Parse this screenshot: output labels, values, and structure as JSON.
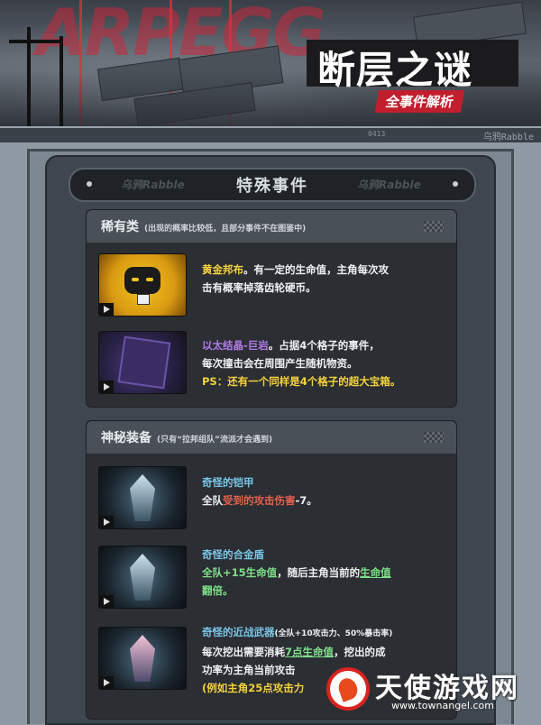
{
  "banner": {
    "bg_logo": "ARPEGG",
    "title": "断层之谜",
    "subtitle": "全事件解析",
    "strip_tag": "乌鸦Rabble",
    "strip_mid": "0413"
  },
  "header": {
    "title": "特殊事件",
    "watermark_left": "乌鸦Rabble",
    "watermark_right": "乌鸦Rabble"
  },
  "sections": [
    {
      "title": "稀有类",
      "note": "(出现的概率比较低，且部分事件不在图鉴中)",
      "items": [
        {
          "name": "黄金邦布",
          "text_1": "。有一定的生命值，主角每次攻",
          "text_2": "击有概率掉落齿轮硬币。"
        },
        {
          "name": "以太结晶-巨岩",
          "text_1": "。占据4个格子的事件，",
          "text_2": "每次撞击会在周围产生随机物资。",
          "ps": "PS：还有一个同样是4个格子的超大宝箱。"
        }
      ]
    },
    {
      "title": "神秘装备",
      "note": "(只有“拉邦组队”流派才会遇到)",
      "items": [
        {
          "name": "奇怪的铠甲",
          "text_1_a": "全队",
          "text_1_b": "受到的攻击伤害",
          "text_1_c": "-7。"
        },
        {
          "name": "奇怪的合金盾",
          "text_1_a": "全队+15生命值",
          "text_1_b": "，随后主角当前的",
          "text_1_c": "生命值",
          "text_2": "翻倍。"
        },
        {
          "name": "奇怪的近战武器",
          "name_note": "(全队+10攻击力、50%暴击率)",
          "text_1_a": "每次挖出需要消耗",
          "text_1_b": "7点生命值",
          "text_1_c": "，挖出的成",
          "text_2": "功率为主角当前攻击",
          "text_3": "(例如主角25点攻击力"
        }
      ]
    }
  ],
  "watermark": {
    "cn": "天使游戏网",
    "url": "www.townangel.com"
  }
}
